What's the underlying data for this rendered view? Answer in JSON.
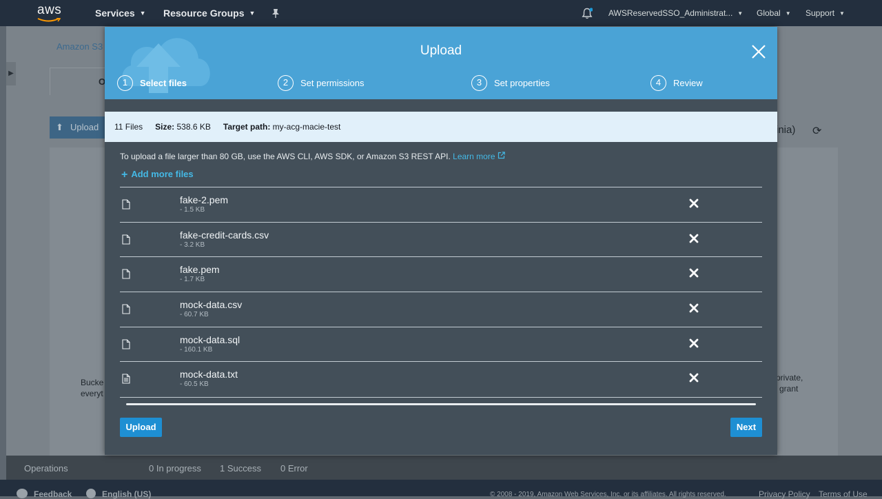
{
  "topnav": {
    "logo": "aws",
    "services": "Services",
    "resource_groups": "Resource Groups",
    "pin_icon": "pushpin-icon",
    "account": "AWSReservedSSO_Administrat...",
    "region": "Global",
    "support": "Support"
  },
  "background": {
    "breadcrumb": "Amazon S3",
    "tab_initial": "O",
    "upload_button": "Upload",
    "region_fragment": "inia)",
    "left_text_1": "Bucke",
    "left_text_2": "everyt",
    "right_text_1": "private,",
    "right_text_2": "grant",
    "operations": {
      "label": "Operations",
      "in_progress": "0 In progress",
      "success": "1 Success",
      "error": "0 Error"
    },
    "bottom": {
      "feedback": "Feedback",
      "language": "English (US)",
      "copyright": "© 2008 - 2019, Amazon Web Services, Inc. or its affiliates. All rights reserved.",
      "privacy": "Privacy Policy",
      "terms": "Terms of Use"
    }
  },
  "modal": {
    "title": "Upload",
    "steps": [
      {
        "num": "1",
        "label": "Select files",
        "active": true
      },
      {
        "num": "2",
        "label": "Set permissions",
        "active": false
      },
      {
        "num": "3",
        "label": "Set properties",
        "active": false
      },
      {
        "num": "4",
        "label": "Review",
        "active": false
      }
    ],
    "summary": {
      "files": "11 Files",
      "size_label": "Size:",
      "size_value": "538.6 KB",
      "target_label": "Target path:",
      "target_value": "my-acg-macie-test"
    },
    "note": "To upload a file larger than 80 GB, use the AWS CLI, AWS SDK, or Amazon S3 REST API.",
    "learn_more": "Learn more",
    "add_more": "Add more files",
    "files": [
      {
        "name": "fake-2.pem",
        "size": "- 1.5 KB",
        "icon": "file-icon"
      },
      {
        "name": "fake-credit-cards.csv",
        "size": "- 3.2 KB",
        "icon": "file-icon"
      },
      {
        "name": "fake.pem",
        "size": "- 1.7 KB",
        "icon": "file-icon"
      },
      {
        "name": "mock-data.csv",
        "size": "- 60.7 KB",
        "icon": "file-icon"
      },
      {
        "name": "mock-data.sql",
        "size": "- 160.1 KB",
        "icon": "file-icon"
      },
      {
        "name": "mock-data.txt",
        "size": "- 60.5 KB",
        "icon": "file-text-icon"
      }
    ],
    "upload_button": "Upload",
    "next_button": "Next"
  },
  "colors": {
    "header_blue": "#4aa3d6",
    "modal_body": "#434f59",
    "summary_bg": "#e1f0fa",
    "link": "#44b9e6",
    "button": "#1e8fd3",
    "topnav": "#232f3e"
  }
}
